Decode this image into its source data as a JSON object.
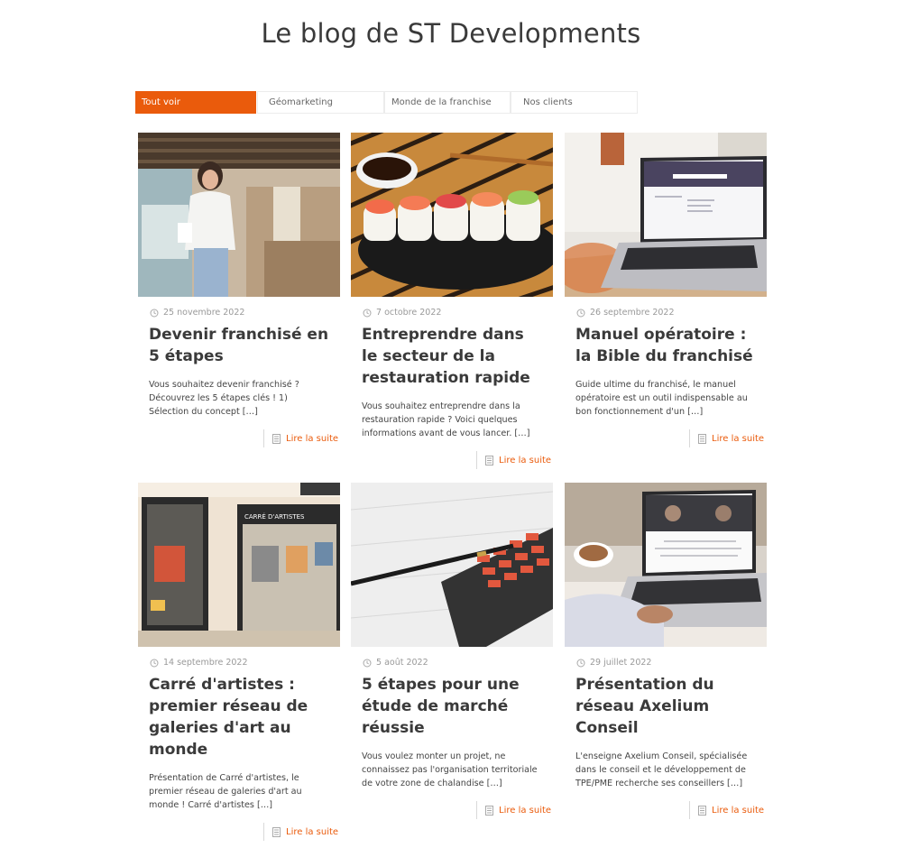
{
  "page": {
    "title": "Le blog de ST Developments"
  },
  "filters": [
    {
      "label": "Tout voir",
      "active": true
    },
    {
      "label": "Géomarketing",
      "active": false
    },
    {
      "label": "Monde de la franchise",
      "active": false
    },
    {
      "label": "Nos clients",
      "active": false
    }
  ],
  "accent_color": "#ea5b0c",
  "read_more_label": "Lire la suite",
  "icons": {
    "date": "clock-icon",
    "read_more": "document-icon"
  },
  "posts": [
    {
      "date": "25 novembre 2022",
      "title": "Devenir franchisé en 5 étapes",
      "excerpt": "Vous souhaitez devenir franchisé ? Découvrez les 5 étapes clés ! 1) Sélection du concept […]",
      "image": "woman-in-cafe-photo"
    },
    {
      "date": "7 octobre 2022",
      "title": "Entreprendre dans le secteur de la restauration rapide",
      "excerpt": "Vous souhaitez entreprendre dans la restauration rapide ? Voici quelques informations avant de vous lancer. […]",
      "image": "sushi-plate-photo"
    },
    {
      "date": "26 septembre 2022",
      "title": "Manuel opératoire : la Bible du franchisé",
      "excerpt": "Guide ultime du franchisé, le manuel opératoire est un outil indispensable au bon fonctionnement d'un […]",
      "image": "laptop-on-desk-photo"
    },
    {
      "date": "14 septembre 2022",
      "title": "Carré d'artistes : premier réseau de galeries d'art au monde",
      "excerpt": "Présentation de Carré d'artistes, le premier réseau de galeries d'art au monde ! Carré d'artistes […]",
      "image": "art-gallery-storefront-photo",
      "sign_text": "CARRÉ D'ARTISTES"
    },
    {
      "date": "5 août 2022",
      "title": "5 étapes pour une étude de marché réussie",
      "excerpt": "Vous voulez monter un projet, ne connaissez pas l'organisation territoriale de votre zone de chalandise […]",
      "image": "calculator-and-pen-photo"
    },
    {
      "date": "29 juillet 2022",
      "title": "Présentation du réseau Axelium Conseil",
      "excerpt": "L'enseigne Axelium Conseil, spécialisée dans le conseil et le développement de TPE/PME recherche ses conseillers […]",
      "image": "laptop-with-coffee-photo"
    }
  ]
}
